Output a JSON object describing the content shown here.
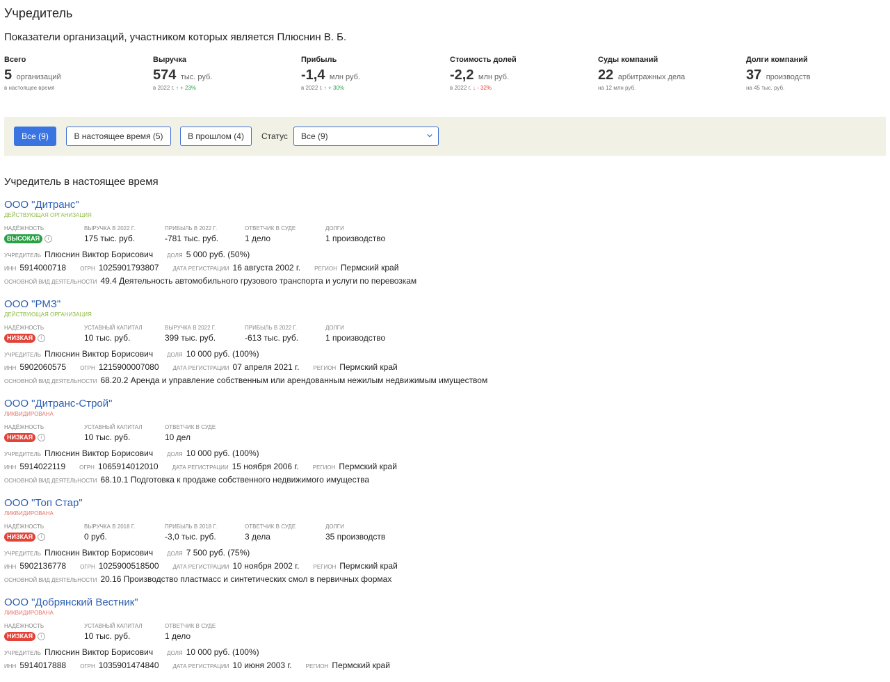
{
  "page": {
    "title": "Учредитель",
    "subtitle": "Показатели организаций, участником которых является Плюснин В. Б."
  },
  "stats": [
    {
      "label": "Всего",
      "value": "5",
      "unit": "организаций",
      "note": "в настоящее время",
      "trend": "",
      "trend_dir": ""
    },
    {
      "label": "Выручка",
      "value": "574",
      "unit": "тыс. руб.",
      "note": "в 2022 г.",
      "trend": "↑ + 23%",
      "trend_dir": "up"
    },
    {
      "label": "Прибыль",
      "value": "-1,4",
      "unit": "млн руб.",
      "note": "в 2022 г.",
      "trend": "↑ + 30%",
      "trend_dir": "up"
    },
    {
      "label": "Стоимость долей",
      "value": "-2,2",
      "unit": "млн руб.",
      "note": "в 2022 г.",
      "trend": "↓ - 32%",
      "trend_dir": "down"
    },
    {
      "label": "Суды компаний",
      "value": "22",
      "unit": "арбитражных дела",
      "note": "на 12 млн руб.",
      "trend": "",
      "trend_dir": ""
    },
    {
      "label": "Долги компаний",
      "value": "37",
      "unit": "производств",
      "note": "на 45 тыс. руб.",
      "trend": "",
      "trend_dir": ""
    }
  ],
  "filters": {
    "all": "Все (9)",
    "current": "В настоящее время (5)",
    "past": "В прошлом (4)",
    "status_label": "Статус",
    "status_value": "Все (9)"
  },
  "section_title": "Учредитель в настоящее время",
  "labels": {
    "reliability": "Надёжность",
    "founder": "Учредитель",
    "share": "Доля",
    "inn": "ИНН",
    "ogrn": "ОГРН",
    "reg_date": "Дата регистрации",
    "region": "Регион",
    "activity": "Основной вид деятельности"
  },
  "orgs": [
    {
      "name": "ООО \"Дитранс\"",
      "status": "Действующая организация",
      "reliability": "Высокая",
      "metrics": [
        {
          "label": "Выручка в 2022 г.",
          "value": "175 тыс. руб."
        },
        {
          "label": "Прибыль в 2022 г.",
          "value": "-781 тыс. руб."
        },
        {
          "label": "Ответчик в суде",
          "value": "1 дело"
        },
        {
          "label": "Долги",
          "value": "1 производство"
        }
      ],
      "founder": "Плюснин Виктор Борисович",
      "share": "5 000 руб. (50%)",
      "inn": "5914000718",
      "ogrn": "1025901793807",
      "reg_date": "16 августа 2002 г.",
      "region": "Пермский край",
      "activity": "49.4 Деятельность автомобильного грузового транспорта и услуги по перевозкам"
    },
    {
      "name": "ООО \"РМЗ\"",
      "status": "Действующая организация",
      "reliability": "Низкая",
      "metrics": [
        {
          "label": "Уставный капитал",
          "value": "10 тыс. руб."
        },
        {
          "label": "Выручка в 2022 г.",
          "value": "399 тыс. руб."
        },
        {
          "label": "Прибыль в 2022 г.",
          "value": "-613 тыс. руб."
        },
        {
          "label": "Долги",
          "value": "1 производство"
        }
      ],
      "founder": "Плюснин Виктор Борисович",
      "share": "10 000 руб. (100%)",
      "inn": "5902060575",
      "ogrn": "1215900007080",
      "reg_date": "07 апреля 2021 г.",
      "region": "Пермский край",
      "activity": "68.20.2 Аренда и управление собственным или арендованным нежилым недвижимым имуществом"
    },
    {
      "name": "ООО \"Дитранс-Строй\"",
      "status": "Ликвидирована",
      "reliability": "Низкая",
      "metrics": [
        {
          "label": "Уставный капитал",
          "value": "10 тыс. руб."
        },
        {
          "label": "Ответчик в суде",
          "value": "10 дел"
        }
      ],
      "founder": "Плюснин Виктор Борисович",
      "share": "10 000 руб. (100%)",
      "inn": "5914022119",
      "ogrn": "1065914012010",
      "reg_date": "15 ноября 2006 г.",
      "region": "Пермский край",
      "activity": "68.10.1 Подготовка к продаже собственного недвижимого имущества"
    },
    {
      "name": "ООО \"Топ Стар\"",
      "status": "Ликвидирована",
      "reliability": "Низкая",
      "metrics": [
        {
          "label": "Выручка в 2018 г.",
          "value": "0 руб."
        },
        {
          "label": "Прибыль в 2018 г.",
          "value": "-3,0 тыс. руб."
        },
        {
          "label": "Ответчик в суде",
          "value": "3 дела"
        },
        {
          "label": "Долги",
          "value": "35 производств"
        }
      ],
      "founder": "Плюснин Виктор Борисович",
      "share": "7 500 руб. (75%)",
      "inn": "5902136778",
      "ogrn": "1025900518500",
      "reg_date": "10 ноября 2002 г.",
      "region": "Пермский край",
      "activity": "20.16 Производство пластмасс и синтетических смол в первичных формах"
    },
    {
      "name": "ООО \"Добрянский Вестник\"",
      "status": "Ликвидирована",
      "reliability": "Низкая",
      "metrics": [
        {
          "label": "Уставный капитал",
          "value": "10 тыс. руб."
        },
        {
          "label": "Ответчик в суде",
          "value": "1 дело"
        }
      ],
      "founder": "Плюснин Виктор Борисович",
      "share": "10 000 руб. (100%)",
      "inn": "5914017888",
      "ogrn": "1035901474840",
      "reg_date": "10 июня 2003 г.",
      "region": "Пермский край",
      "activity": ""
    }
  ]
}
